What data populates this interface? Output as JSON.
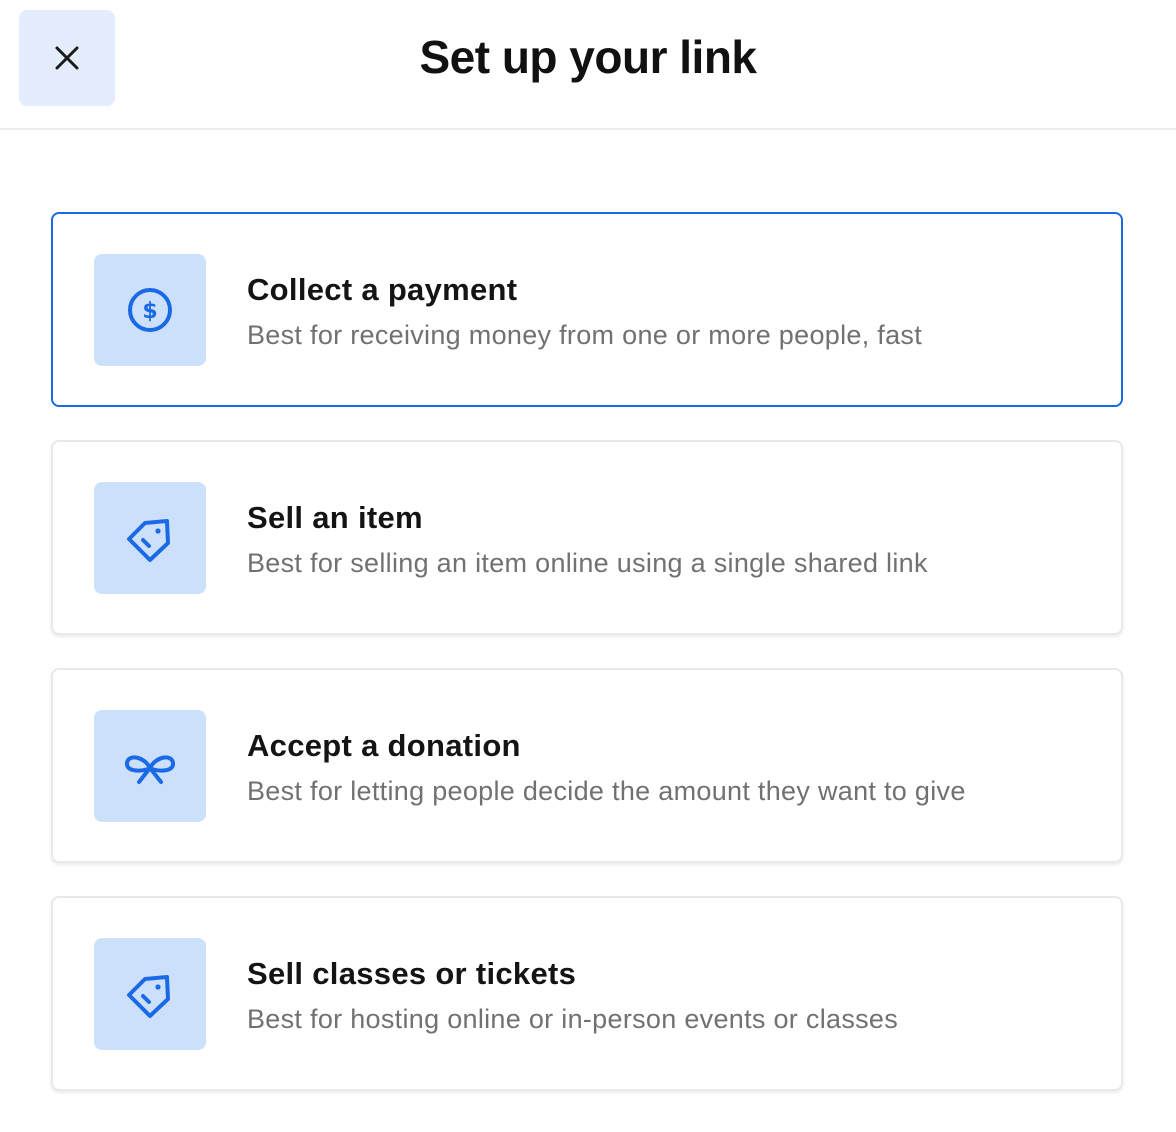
{
  "header": {
    "title": "Set up your link",
    "close_icon": "close-icon"
  },
  "options": [
    {
      "title": "Collect a payment",
      "description": "Best for receiving money from one or more people, fast",
      "icon": "dollar-circle-icon",
      "selected": true
    },
    {
      "title": "Sell an item",
      "description": "Best for selling an item online using a single shared link",
      "icon": "price-tag-icon",
      "selected": false
    },
    {
      "title": "Accept a donation",
      "description": "Best for letting people decide the amount they want to give",
      "icon": "ribbon-icon",
      "selected": false
    },
    {
      "title": "Sell classes or tickets",
      "description": "Best for hosting online or in-person events or classes",
      "icon": "price-tag-icon",
      "selected": false
    }
  ],
  "colors": {
    "accent": "#1a6ae6",
    "icon_tile": "#cde0fb",
    "close_tile": "#e3edfc",
    "title_text": "#141414",
    "description_text": "#717171"
  }
}
